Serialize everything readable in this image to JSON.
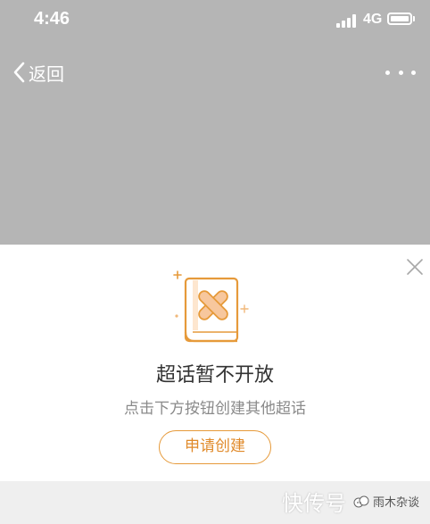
{
  "status_bar": {
    "time": "4:46",
    "network": "4G",
    "icons": [
      "signal-icon",
      "battery-icon"
    ]
  },
  "nav_bar": {
    "back_label": "返回",
    "icons": [
      "chevron-left-icon",
      "more-dots-icon"
    ]
  },
  "panel": {
    "title": "超话暂不开放",
    "subtitle": "点击下方按钮创建其他超话",
    "button_label": "申请创建",
    "icons": [
      "close-icon",
      "book-x-icon",
      "sparkle-icon"
    ]
  },
  "watermark": {
    "text": "快传号",
    "name": "雨木杂谈"
  },
  "colors": {
    "overlay_gray": "#b5b5b5",
    "accent_orange": "#e69a3a",
    "title_text": "#333333",
    "subtitle_text": "#8a8a8a",
    "bottom_strip": "#efefef"
  }
}
